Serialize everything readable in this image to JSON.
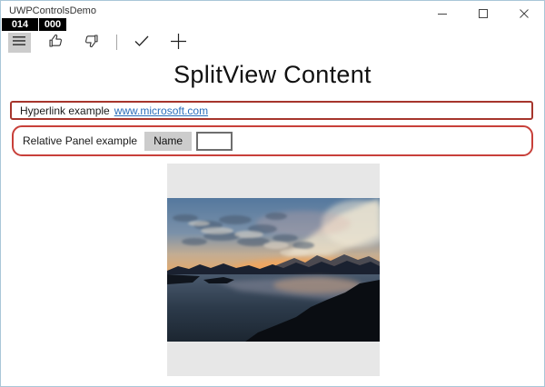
{
  "window": {
    "title": "UWPControlsDemo",
    "controls": {
      "minimize": "minimize",
      "maximize": "maximize",
      "close": "close"
    }
  },
  "debug_counter": {
    "values": [
      "014",
      "000"
    ]
  },
  "toolbar": {
    "items": [
      "hamburger-menu",
      "like",
      "dislike",
      "divider",
      "accept",
      "add"
    ]
  },
  "main": {
    "heading": "SplitView Content",
    "hyperlink_panel": {
      "label": "Hyperlink example",
      "link_text": "www.microsoft.com"
    },
    "relative_panel": {
      "label": "Relative Panel example",
      "name_button_label": "Name",
      "name_input_value": ""
    },
    "photo": "sunset-over-lake"
  },
  "colors": {
    "window_border": "#a9c7d8",
    "hyperlink_panel_border": "#a6352c",
    "relative_panel_border": "#c8403a",
    "link": "#2a6ebb",
    "counter_bg": "#000000",
    "counter_text": "#ffffff",
    "toolbar_button_bg": "#cccccc",
    "image_frame_bg": "#e7e7e7"
  }
}
